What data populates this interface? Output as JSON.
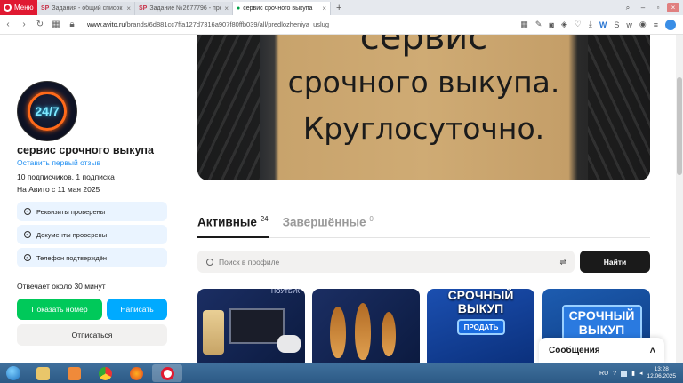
{
  "browser": {
    "menu_label": "Меню",
    "tabs": [
      {
        "favicon": "SP",
        "title": "Задания - общий список"
      },
      {
        "favicon": "SP",
        "title": "Задание №2677796 - про"
      },
      {
        "favicon": "av",
        "title": "сервис срочного выкупа"
      }
    ],
    "url_host": "www.avito.ru",
    "url_path": "/brands/6d881cc7ffa127d7316a907f80ffb039/all/predlozheniya_uslug"
  },
  "shop": {
    "avatar_text": "24/7",
    "name": "сервис срочного выкупа",
    "review_link": "Оставить первый отзыв",
    "subscribers": "10 подписчиков, 1 подписка",
    "since": "На Авито с 11 мая 2025",
    "checks": [
      "Реквизиты проверены",
      "Документы проверены",
      "Телефон подтверждён"
    ],
    "response": "Отвечает около 30 минут",
    "show_phone_label": "Показать номер",
    "write_label": "Написать",
    "unsubscribe_label": "Отписаться"
  },
  "banner": {
    "line1": "сервис",
    "line2": "срочного выкупа.",
    "line3": "Круглосуточно."
  },
  "listing_tabs": {
    "active_label": "Активные",
    "active_count": "24",
    "done_label": "Завершённые",
    "done_count": "0"
  },
  "search": {
    "placeholder": "Поиск в профиле",
    "button_label": "Найти"
  },
  "cards": {
    "c1_label": "НОУТБУК",
    "c3_text": "СРОЧНЫЙ ВЫКУП",
    "c3_button": "ПРОДАТЬ",
    "c4_line1": "СРОЧНЫЙ",
    "c4_line2": "ВЫКУП"
  },
  "messages": {
    "label": "Сообщения"
  },
  "taskbar": {
    "lang": "RU",
    "time": "13:28",
    "date": "12.06.2025"
  },
  "colors": {
    "green": "#00c95a",
    "blue": "#00aaff",
    "link": "#1f8ef1",
    "opera_red": "#e01931"
  }
}
